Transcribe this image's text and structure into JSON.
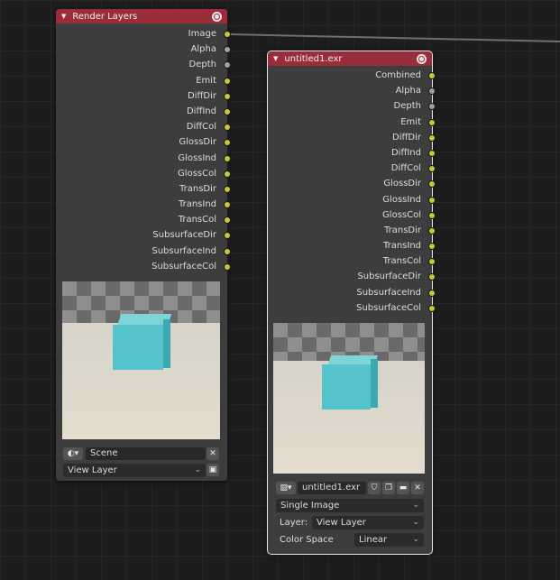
{
  "render_layers": {
    "title": "Render Layers",
    "outputs": [
      "Image",
      "Alpha",
      "Depth",
      "Emit",
      "DiffDir",
      "DiffInd",
      "DiffCol",
      "GlossDir",
      "GlossInd",
      "GlossCol",
      "TransDir",
      "TransInd",
      "TransCol",
      "SubsurfaceDir",
      "SubsurfaceInd",
      "SubsurfaceCol"
    ],
    "scene_value": "Scene",
    "layer_value": "View Layer"
  },
  "image_node": {
    "title": "untitled1.exr",
    "outputs": [
      "Combined",
      "Alpha",
      "Depth",
      "Emit",
      "DiffDir",
      "DiffInd",
      "DiffCol",
      "GlossDir",
      "GlossInd",
      "GlossCol",
      "TransDir",
      "TransInd",
      "TransCol",
      "SubsurfaceDir",
      "SubsurfaceInd",
      "SubsurfaceCol"
    ],
    "image_name": "untitled1.exr",
    "source_type": "Single Image",
    "layer_label": "Layer:",
    "layer_value": "View Layer",
    "color_space_label": "Color Space",
    "color_space_value": "Linear"
  },
  "colors": {
    "header": "#9b2d3a",
    "socket_color": "#c8c832",
    "socket_value": "#a1a1a1"
  }
}
